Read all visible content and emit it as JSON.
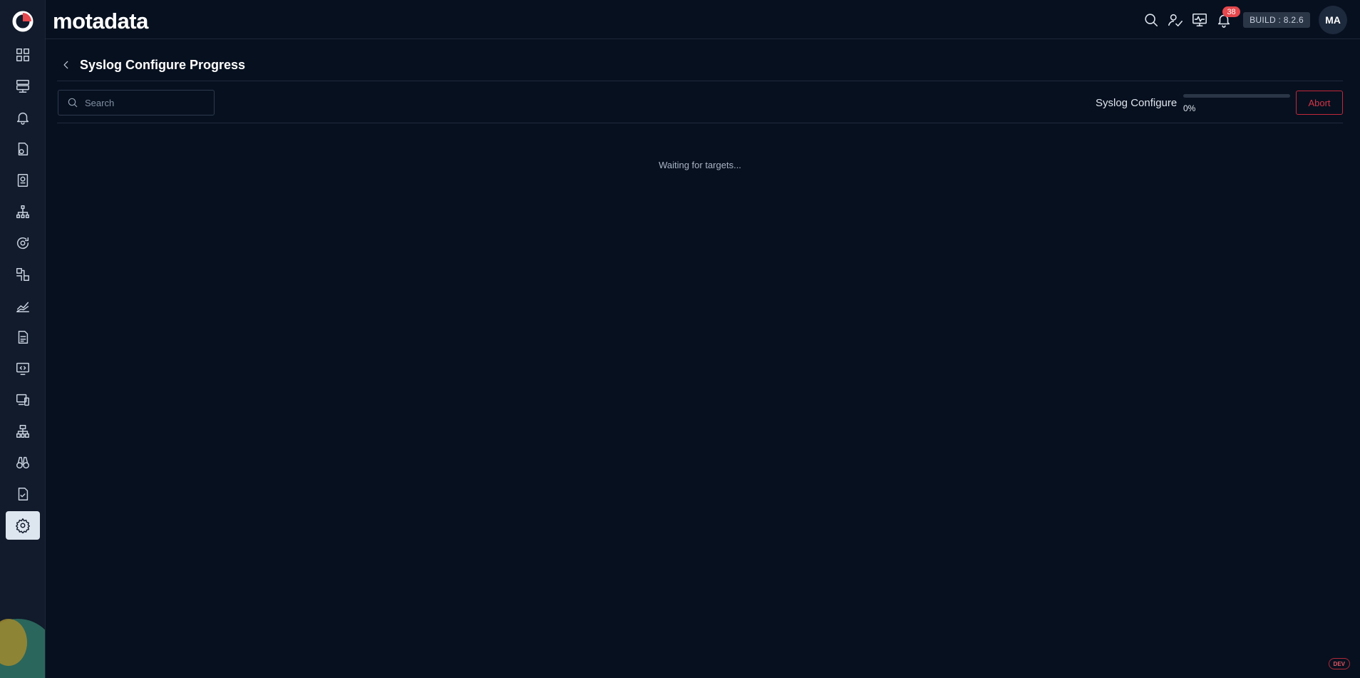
{
  "app": {
    "brand": "motadata"
  },
  "topbar": {
    "notification_count": "38",
    "build": "BUILD : 8.2.6",
    "avatar_initials": "MA",
    "icons": [
      "search-icon",
      "user-check-icon",
      "monitor-activity-icon",
      "bell-icon"
    ]
  },
  "sidebar": {
    "items": [
      {
        "icon": "dashboard-grid-icon"
      },
      {
        "icon": "server-icon"
      },
      {
        "icon": "alert-bell-icon"
      },
      {
        "icon": "policy-file-icon"
      },
      {
        "icon": "report-icon"
      },
      {
        "icon": "topology-icon"
      },
      {
        "icon": "discovery-icon"
      },
      {
        "icon": "flow-icon"
      },
      {
        "icon": "metric-chart-icon"
      },
      {
        "icon": "log-file-icon"
      },
      {
        "icon": "code-monitor-icon"
      },
      {
        "icon": "device-icon"
      },
      {
        "icon": "network-icon"
      },
      {
        "icon": "binoculars-icon"
      },
      {
        "icon": "audit-check-icon"
      },
      {
        "icon": "settings-gear-icon",
        "active": true
      }
    ]
  },
  "page": {
    "title": "Syslog Configure Progress"
  },
  "toolbar": {
    "search_placeholder": "Search",
    "progress_label": "Syslog Configure",
    "progress_value": 0,
    "progress_percent_text": "0%",
    "abort_label": "Abort"
  },
  "main": {
    "empty_text": "Waiting for targets..."
  },
  "env_badge": "DEV",
  "colors": {
    "background": "#07101f",
    "sidebar": "#111b2b",
    "danger": "#d23546",
    "badge": "#e5484d"
  }
}
